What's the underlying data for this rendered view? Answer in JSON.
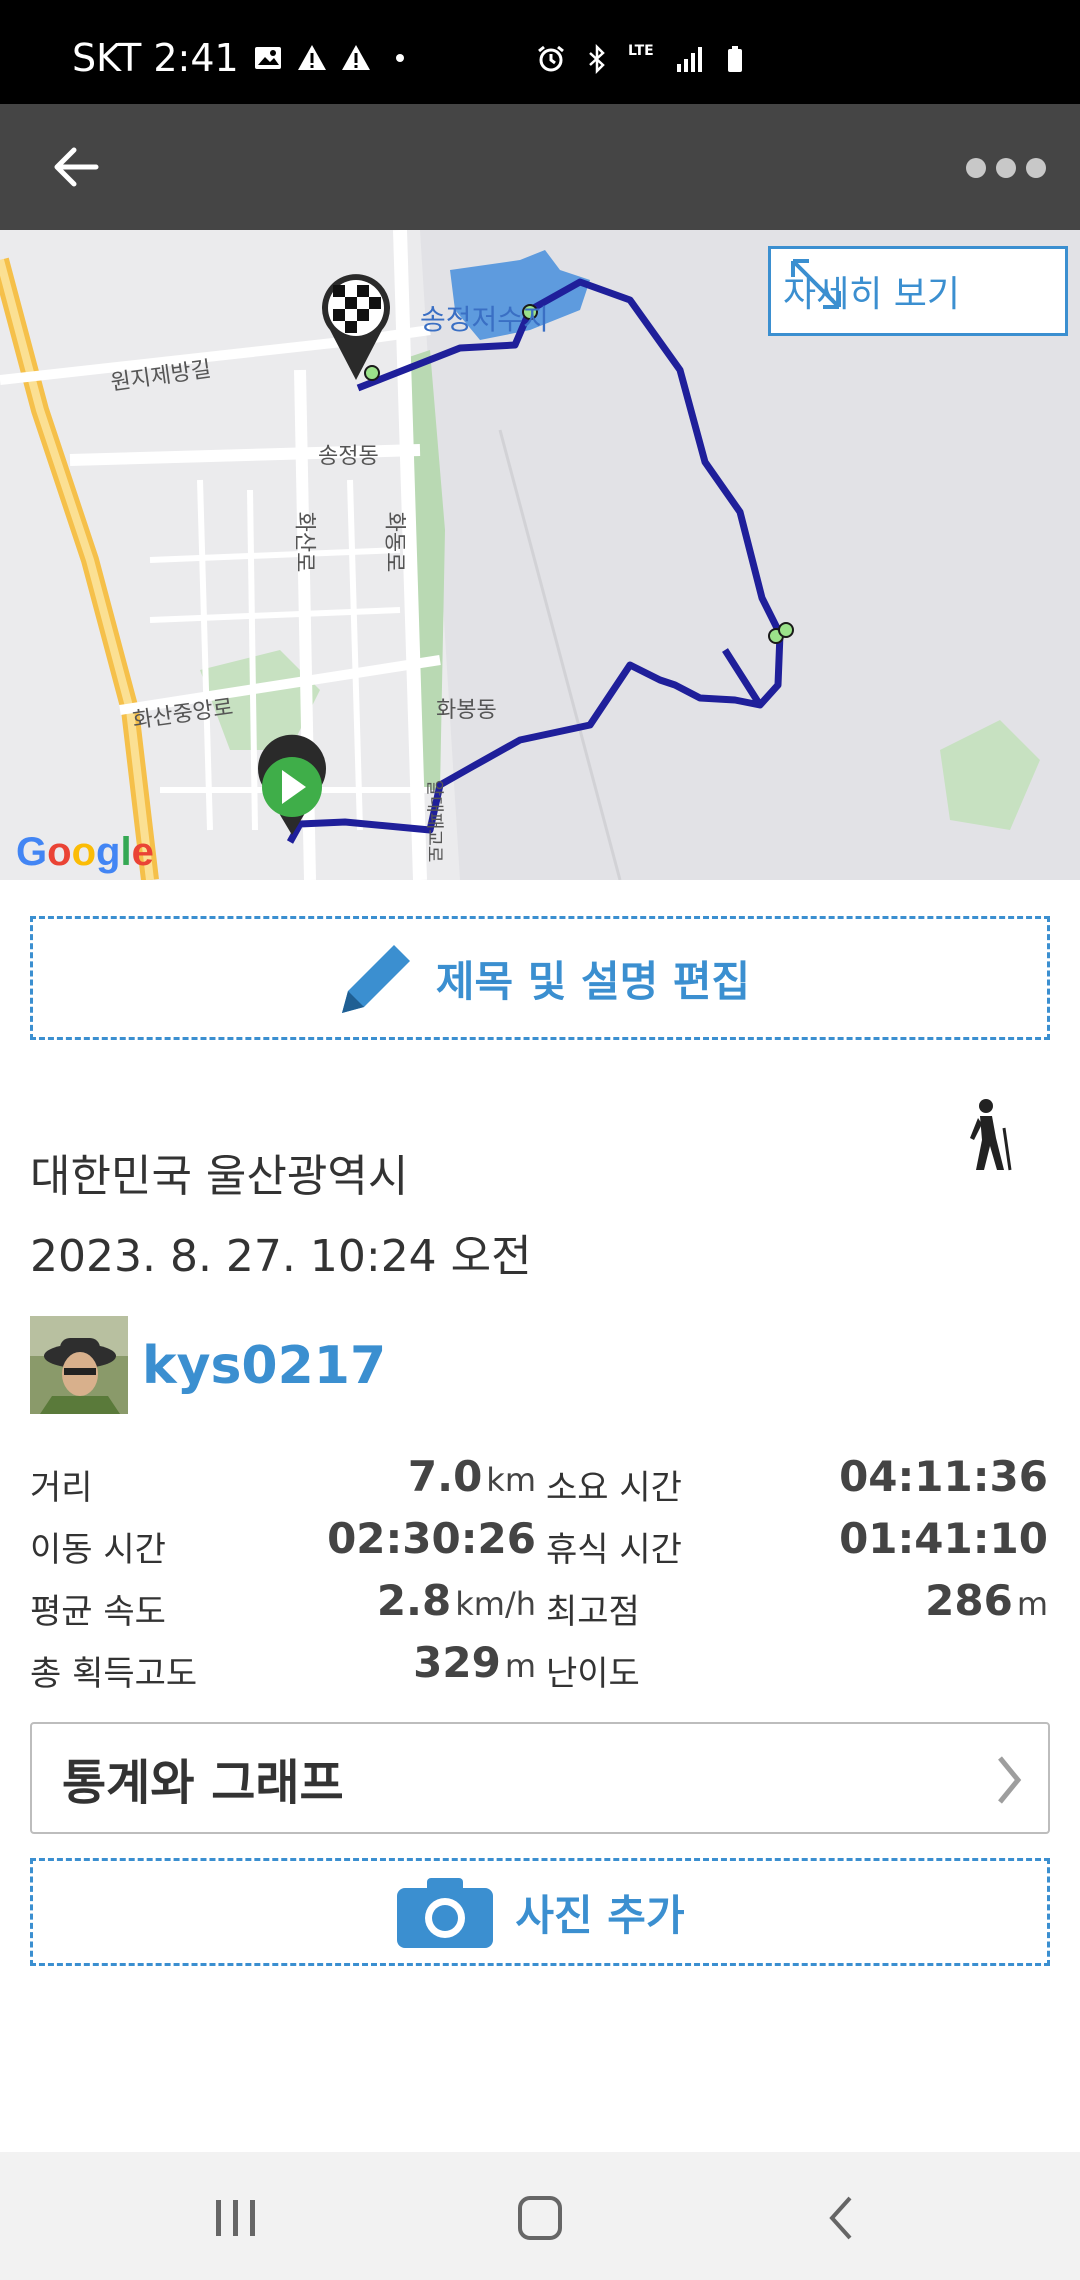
{
  "status_bar": {
    "carrier_time": "SKT 2:41",
    "icons": [
      "image-icon",
      "warning-icon",
      "warning-icon",
      "dot-icon",
      "alarm-icon",
      "bluetooth-icon",
      "lte-icon",
      "signal-icon",
      "battery-icon"
    ],
    "network": "LTE"
  },
  "appbar": {
    "back_icon": "arrow-left-icon",
    "more_icon": "more-dots-icon"
  },
  "map": {
    "detail_button": "자세히 보기",
    "labels": {
      "reservoir": "송정저수지",
      "road1": "원지제방길",
      "district1": "송정동",
      "road2": "화산로",
      "road3": "화동로",
      "road4": "화산중앙로",
      "district2": "화봉동",
      "road5": "알대패교로"
    },
    "google": "Google",
    "route_color": "#1f1f9a"
  },
  "edit_button": "제목 및 설명 편집",
  "activity": {
    "location": "대한민국 울산광역시",
    "datetime": "2023. 8. 27. 10:24 오전",
    "type_icon": "hiker-icon"
  },
  "user": {
    "username": "kys0217"
  },
  "stats": {
    "distance_label": "거리",
    "distance_value": "7.0",
    "distance_unit": "km",
    "duration_label": "소요 시간",
    "duration_value": "04:11:36",
    "moving_label": "이동 시간",
    "moving_value": "02:30:26",
    "rest_label": "휴식 시간",
    "rest_value": "01:41:10",
    "speed_label": "평균 속도",
    "speed_value": "2.8",
    "speed_unit": "km/h",
    "highest_label": "최고점",
    "highest_value": "286",
    "highest_unit": "m",
    "gain_label": "총 획득고도",
    "gain_value": "329",
    "gain_unit": "m",
    "difficulty_label": "난이도"
  },
  "stats_button": "통계와 그래프",
  "photo_button": "사진 추가",
  "colors": {
    "accent": "#3b8fd0",
    "appbar": "#454545"
  }
}
